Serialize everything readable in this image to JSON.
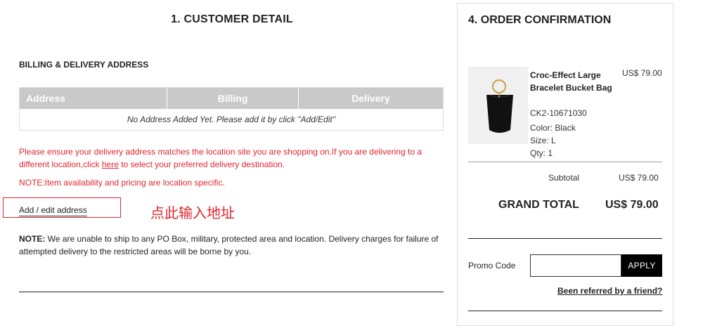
{
  "customer": {
    "title": "1. CUSTOMER DETAIL",
    "billing_title": "BILLING & DELIVERY ADDRESS",
    "table": {
      "columns": [
        "Address",
        "Billing",
        "Delivery"
      ],
      "empty_text": "No Address Added Yet. Please add it by click \"Add/Edit\""
    },
    "warning": {
      "before": "Please ensure your delivery address matches the location site you are shopping on.If you are delivering to a different location,click ",
      "link": "here",
      "after": " to select your preferred delivery destination."
    },
    "location_note": "NOTE:Item availability and pricing are location specific.",
    "add_edit_label": "Add / edit address",
    "hint_zh": "点此输入地址",
    "ship_note": {
      "label": "NOTE:",
      "text": " We are unable to ship to any PO Box, military, protected area and location. Delivery charges for failure of attempted delivery to the restricted areas will be borne by you."
    }
  },
  "order": {
    "title": "4. ORDER CONFIRMATION",
    "product": {
      "name": "Croc-Effect Large Bracelet Bucket Bag",
      "price": "US$ 79.00",
      "sku": "CK2-10671030",
      "color": "Color: Black",
      "size": "Size: L",
      "qty": "Qty: 1"
    },
    "subtotal_label": "Subtotal",
    "subtotal_value": "US$ 79.00",
    "grand_total_label": "GRAND TOTAL",
    "grand_total_value": "US$ 79.00",
    "promo_label": "Promo Code",
    "promo_value": "",
    "apply_label": "APPLY",
    "referred_link": "Been referred by a friend?"
  },
  "colors": {
    "warning_red": "#e0262d",
    "table_header_bg": "#c9c9c9",
    "apply_bg": "#000000"
  }
}
